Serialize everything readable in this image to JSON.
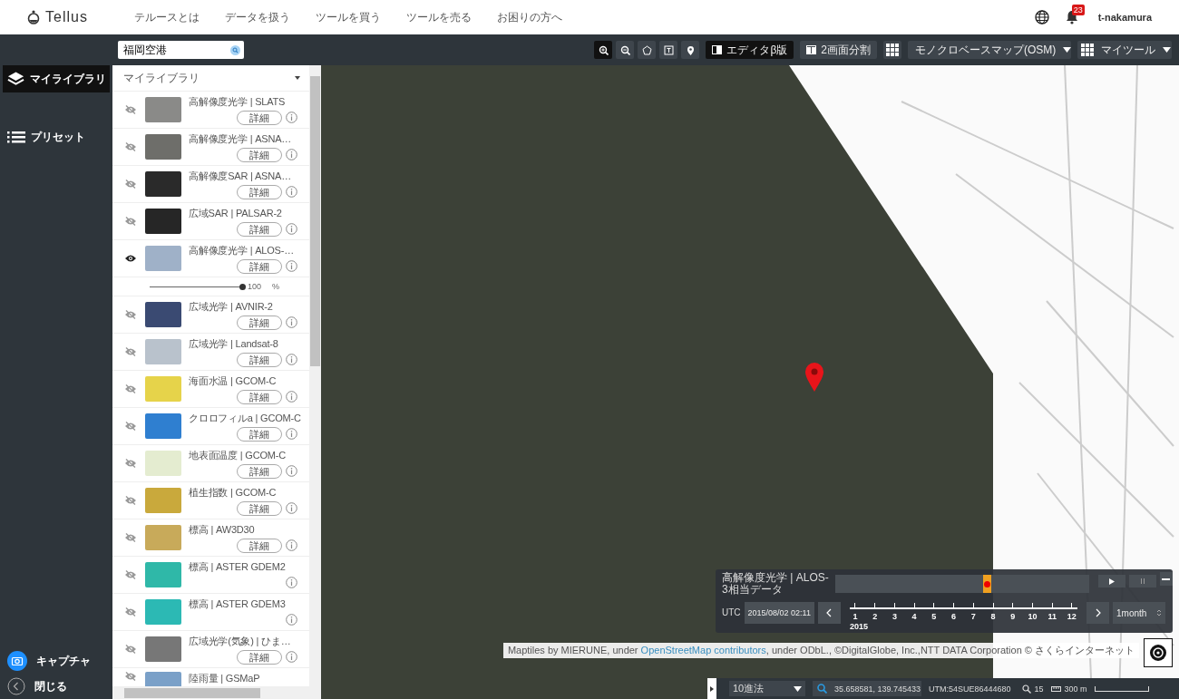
{
  "header": {
    "logo": "Tellus",
    "nav": [
      "テルースとは",
      "データを扱う",
      "ツールを買う",
      "ツールを売る",
      "お困りの方へ"
    ],
    "notification_count": "23",
    "user": "t-nakamura"
  },
  "toolbar": {
    "search": {
      "value": "福岡空港"
    },
    "tools": [
      {
        "kind": "zoom-in",
        "selected": true
      },
      {
        "kind": "zoom-out",
        "selected": false
      },
      {
        "kind": "polygon",
        "selected": false
      },
      {
        "kind": "text",
        "selected": false
      },
      {
        "kind": "pin",
        "selected": false
      }
    ],
    "editor_button": "エディタβ版",
    "split_button": "2画面分割",
    "basemap": "モノクロベースマップ(OSM)",
    "mytools": "マイツール"
  },
  "sidebar": {
    "items": [
      {
        "label": "マイライブラリ",
        "kind": "layers",
        "selected": true
      },
      {
        "label": "プリセット",
        "kind": "list",
        "selected": false
      }
    ],
    "capture": "キャプチャ",
    "close": "閉じる"
  },
  "library": {
    "title": "マイライブラリ",
    "layers": [
      {
        "title": "高解像度光学 | SLATS",
        "visible": false,
        "detail": "詳細",
        "info": true
      },
      {
        "title": "高解像度光学 | ASNA…",
        "visible": false,
        "detail": "詳細",
        "info": true
      },
      {
        "title": "高解像度SAR | ASNA…",
        "visible": false,
        "detail": "詳細",
        "info": true
      },
      {
        "title": "広域SAR | PALSAR-2",
        "visible": false,
        "detail": "詳細",
        "info": true
      },
      {
        "title": "高解像度光学 | ALOS-…",
        "visible": true,
        "detail": "詳細",
        "info": true,
        "opacity": {
          "level": 1,
          "reading": "100",
          "unit": "%"
        }
      },
      {
        "title": "広域光学 | AVNIR-2",
        "visible": false,
        "detail": "詳細",
        "info": true
      },
      {
        "title": "広域光学 | Landsat-8",
        "visible": false,
        "detail": "詳細",
        "info": true
      },
      {
        "title": "海面水温 | GCOM-C",
        "visible": false,
        "detail": "詳細",
        "info": true
      },
      {
        "title": "クロロフィルa | GCOM-C",
        "visible": false,
        "detail": "詳細",
        "info": true
      },
      {
        "title": "地表面温度 | GCOM-C",
        "visible": false,
        "detail": "詳細",
        "info": true
      },
      {
        "title": "植生指数 | GCOM-C",
        "visible": false,
        "detail": "詳細",
        "info": true
      },
      {
        "title": "標高 | AW3D30",
        "visible": false,
        "detail": "詳細",
        "info": true
      },
      {
        "title": "標高 | ASTER GDEM2",
        "visible": false,
        "info": true
      },
      {
        "title": "標高 | ASTER GDEM3",
        "visible": false,
        "info": true
      },
      {
        "title": "広域光学(気象) | ひま…",
        "visible": false,
        "detail": "詳細",
        "info": true
      },
      {
        "title": "陸雨量 | GSMaP",
        "visible": false,
        "info": false
      }
    ]
  },
  "timeline": {
    "title": "高解像度光学 | ALOS-3相当データ",
    "level": 0.6,
    "utc_label": "UTC",
    "datetime": "2015/08/02 02:11",
    "months": [
      "1",
      "2",
      "3",
      "4",
      "5",
      "6",
      "7",
      "8",
      "9",
      "10",
      "11",
      "12"
    ],
    "year": "2015",
    "interval": "1month"
  },
  "attribution": {
    "text_before": "Maptiles by MIERUNE, under ",
    "link": "OpenStreetMap contributors",
    "text_after": ", under ODbL., ©DigitalGlobe, Inc.,NTT DATA Corporation © さくらインターネット"
  },
  "status_bar": {
    "notation": "10進法",
    "coordinates": "35.658581, 139.745433",
    "utm": "UTM:54SUE86444680",
    "zoom": "15",
    "scale": "300 m"
  }
}
